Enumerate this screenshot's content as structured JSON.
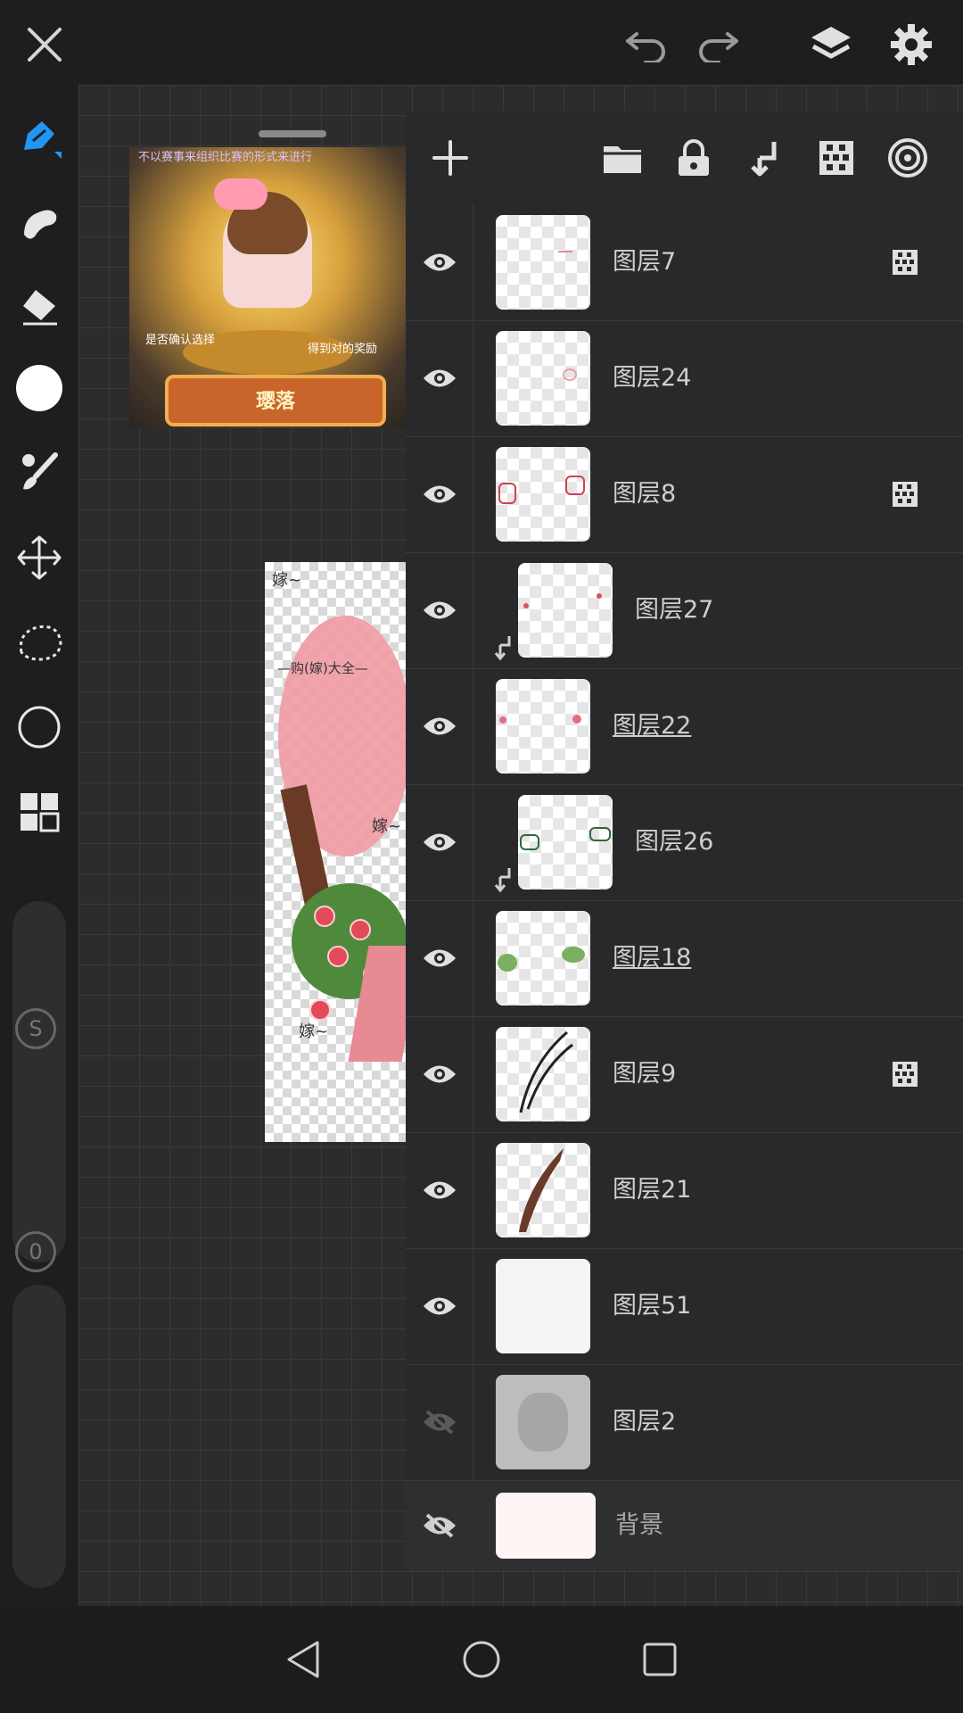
{
  "top_bar": {
    "close_icon": "close-icon",
    "undo_icon": "undo-icon",
    "redo_icon": "redo-icon",
    "layers_icon": "layers-icon",
    "settings_icon": "gear-icon"
  },
  "toolbar": {
    "tools": [
      "pen",
      "smudge",
      "eraser",
      "color",
      "brush-settings",
      "transform",
      "lasso-select",
      "shape",
      "gallery"
    ],
    "size_slider_label": "S",
    "opacity_slider_label": "0"
  },
  "reference_image": {
    "banner_text": "璎落",
    "caption_left": "是否确认选择",
    "caption_right": "得到对的奖励",
    "top_text": "不以赛事来组织比赛的形式来进行"
  },
  "artwork": {
    "labels": [
      "嫁~",
      "—购(嫁)大全—",
      "嫁~",
      "嫁~"
    ]
  },
  "layer_panel": {
    "header_buttons": [
      "add-layer",
      "folder",
      "lock",
      "clip",
      "alpha-lock",
      "blend"
    ],
    "layers": [
      {
        "name": "图层7",
        "visible": true,
        "clipped": false,
        "alpha_locked": true,
        "active": false
      },
      {
        "name": "图层24",
        "visible": true,
        "clipped": false,
        "alpha_locked": false,
        "active": false
      },
      {
        "name": "图层8",
        "visible": true,
        "clipped": false,
        "alpha_locked": true,
        "active": false
      },
      {
        "name": "图层27",
        "visible": true,
        "clipped": true,
        "alpha_locked": false,
        "active": false
      },
      {
        "name": "图层22",
        "visible": true,
        "clipped": false,
        "alpha_locked": false,
        "active": true
      },
      {
        "name": "图层26",
        "visible": true,
        "clipped": true,
        "alpha_locked": false,
        "active": false
      },
      {
        "name": "图层18",
        "visible": true,
        "clipped": false,
        "alpha_locked": false,
        "active": true
      },
      {
        "name": "图层9",
        "visible": true,
        "clipped": false,
        "alpha_locked": true,
        "active": false
      },
      {
        "name": "图层21",
        "visible": true,
        "clipped": false,
        "alpha_locked": false,
        "active": false
      },
      {
        "name": "图层51",
        "visible": true,
        "clipped": false,
        "alpha_locked": false,
        "active": false
      },
      {
        "name": "图层2",
        "visible": false,
        "clipped": false,
        "alpha_locked": false,
        "active": false
      }
    ],
    "background": {
      "name": "背景",
      "visible": false,
      "color": "#fff5f5"
    }
  },
  "nav_bar": {
    "back_icon": "back-triangle-icon",
    "home_icon": "home-circle-icon",
    "recents_icon": "recents-square-icon"
  },
  "colors": {
    "accent": "#2196f3",
    "panel": "#29292b",
    "background": "#1f1f21"
  }
}
